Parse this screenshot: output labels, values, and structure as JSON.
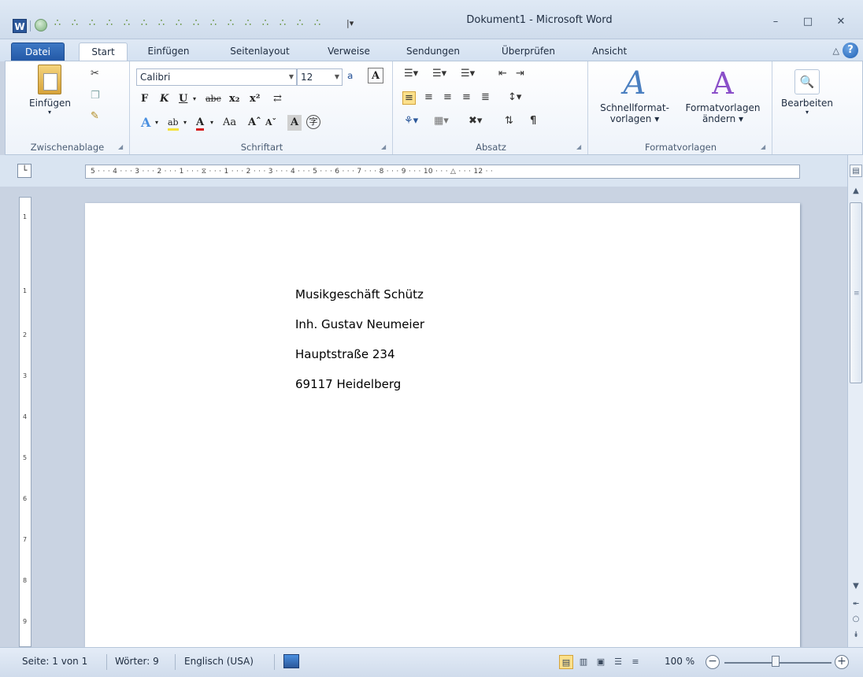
{
  "window": {
    "title": "Dokument1 - Microsoft Word",
    "app_icon": "W",
    "qat_dropdown": "|▾"
  },
  "controls": {
    "minimize": "–",
    "maximize": "□",
    "close": "✕"
  },
  "tabs": [
    {
      "label": "Datei"
    },
    {
      "label": "Start"
    },
    {
      "label": "Einfügen"
    },
    {
      "label": "Seitenlayout"
    },
    {
      "label": "Verweise"
    },
    {
      "label": "Sendungen"
    },
    {
      "label": "Überprüfen"
    },
    {
      "label": "Ansicht"
    }
  ],
  "ribbon": {
    "clipboard": {
      "paste_label": "Einfügen",
      "group_label": "Zwischenablage"
    },
    "font": {
      "font_name": "Calibri",
      "font_size": "12",
      "group_label": "Schriftart"
    },
    "paragraph": {
      "group_label": "Absatz"
    },
    "styles": {
      "quick_styles_line1": "Schnellformat-",
      "quick_styles_line2": "vorlagen ▾",
      "change_styles_line1": "Formatvorlagen",
      "change_styles_line2": "ändern ▾",
      "group_label": "Formatvorlagen"
    },
    "editing": {
      "label": "Bearbeiten"
    }
  },
  "ruler": {
    "horizontal_text": "5 · · · 4 · · · 3 · · · 2 · · · 1 · · · ⧖ · · · 1 · · · 2 · · · 3 · · · 4 · · · 5 · · · 6 · · · 7 · · · 8 · · · 9 · · · 10 · · · △ · · · 12 · ·",
    "vertical_marks": [
      "1",
      "1",
      "2",
      "3",
      "4",
      "5",
      "6",
      "7",
      "8",
      "9"
    ]
  },
  "document": {
    "lines": [
      "Musikgeschäft Schütz",
      "Inh. Gustav Neumeier",
      "Hauptstraße 234",
      "69117 Heidelberg"
    ]
  },
  "status": {
    "page": "Seite: 1 von 1",
    "words": "Wörter: 9",
    "language": "Englisch (USA)",
    "zoom": "100 %",
    "zoom_level_percent": 100
  }
}
